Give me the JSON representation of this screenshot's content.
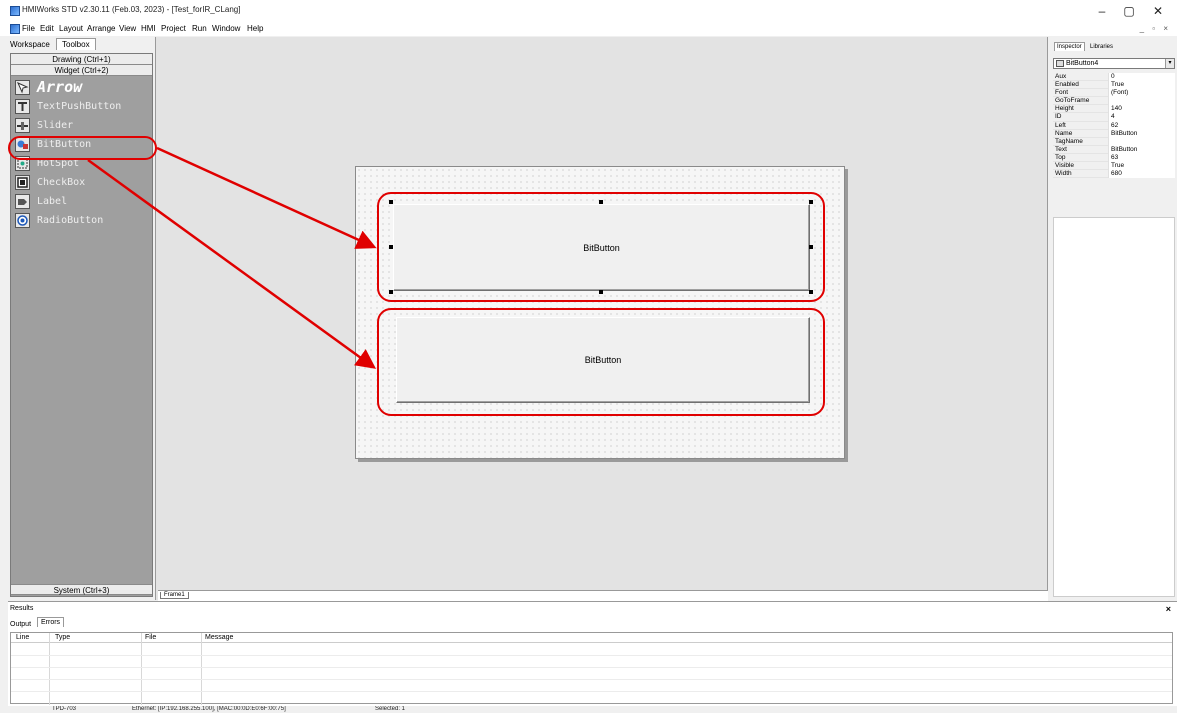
{
  "window": {
    "title": "HMIWorks STD v2.30.11 (Feb.03, 2023) - [Test_forIR_CLang]",
    "minimize": "–",
    "maximize": "▢",
    "close": "✕"
  },
  "menu": {
    "items": [
      "File",
      "Edit",
      "Layout",
      "Arrange",
      "View",
      "HMI",
      "Project",
      "Run",
      "Window",
      "Help"
    ],
    "mdi_buttons": "_ ▫ ×"
  },
  "left_panel": {
    "tabs": [
      "Workspace",
      "Toolbox"
    ],
    "drawing": "Drawing (Ctrl+1)",
    "widget": "Widget (Ctrl+2)",
    "system": "System (Ctrl+3)",
    "tools": [
      {
        "label": "Arrow",
        "icon": "arrow-cursor-icon"
      },
      {
        "label": "TextPushButton",
        "icon": "text-push-button-icon"
      },
      {
        "label": "Slider",
        "icon": "slider-icon"
      },
      {
        "label": "BitButton",
        "icon": "bit-button-icon"
      },
      {
        "label": "HotSpot",
        "icon": "hotspot-icon"
      },
      {
        "label": "CheckBox",
        "icon": "checkbox-icon"
      },
      {
        "label": "Label",
        "icon": "label-icon"
      },
      {
        "label": "RadioButton",
        "icon": "radio-button-icon"
      }
    ]
  },
  "canvas": {
    "frame_tab": "Frame1",
    "buttons": [
      "BitButton",
      "BitButton"
    ]
  },
  "inspector": {
    "tabs": [
      "Inspector",
      "Libraries"
    ],
    "selected_object": "BitButton4",
    "properties": [
      {
        "name": "Aux",
        "value": "0"
      },
      {
        "name": "Enabled",
        "value": "True"
      },
      {
        "name": "Font",
        "value": "(Font)"
      },
      {
        "name": "GoToFrame",
        "value": ""
      },
      {
        "name": "Height",
        "value": "140"
      },
      {
        "name": "ID",
        "value": "4"
      },
      {
        "name": "Left",
        "value": "62"
      },
      {
        "name": "Name",
        "value": "BitButton"
      },
      {
        "name": "TagName",
        "value": ""
      },
      {
        "name": "Text",
        "value": "BitButton"
      },
      {
        "name": "Top",
        "value": "63"
      },
      {
        "name": "Visible",
        "value": "True"
      },
      {
        "name": "Width",
        "value": "680"
      }
    ]
  },
  "results": {
    "title": "Results",
    "close": "×",
    "tabs": [
      "Output",
      "Errors"
    ],
    "columns": [
      "Line",
      "Type",
      "File",
      "Message"
    ]
  },
  "status": {
    "device": "TPD-703",
    "connection": "Ethernet: [IP:192.168.255.100], [MAC:00:0D:E0:6F:00:75]",
    "selected": "Selected: 1"
  },
  "colors": {
    "highlight": "#e00000",
    "toolbox_bg": "#9f9f9f"
  }
}
